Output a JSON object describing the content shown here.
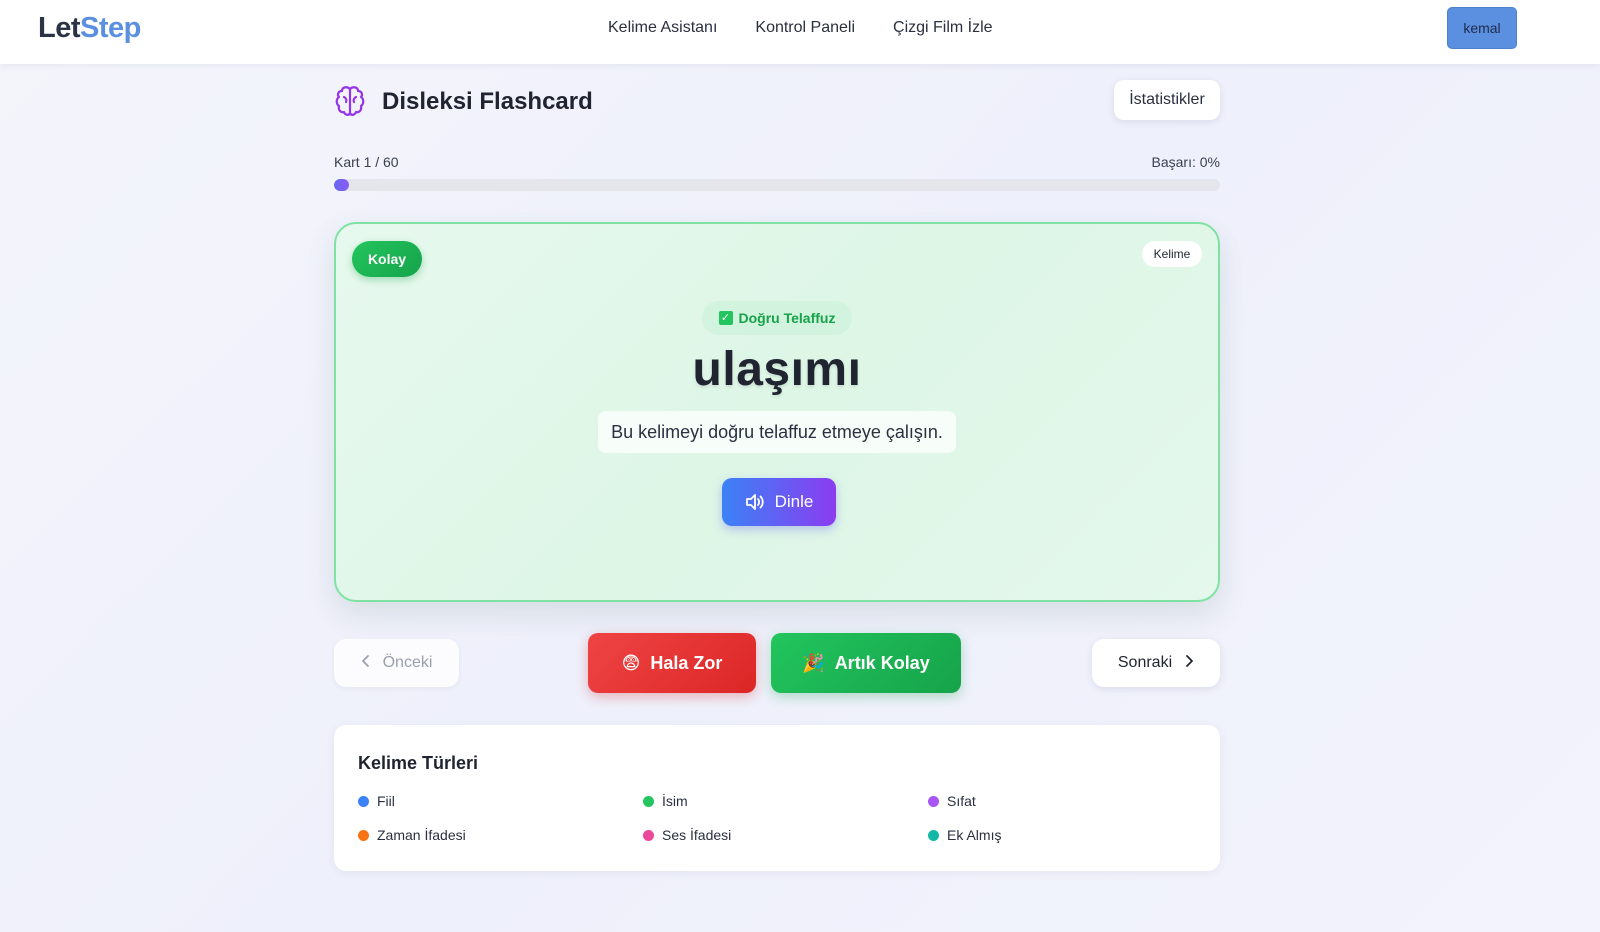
{
  "brand": {
    "part1": "Let",
    "part2": "Step",
    "color_part2": "#5b8fe0"
  },
  "nav": {
    "links": [
      "Kelime Asistanı",
      "Kontrol Paneli",
      "Çizgi Film İzle"
    ],
    "user": "kemal"
  },
  "header": {
    "title": "Disleksi Flashcard",
    "icon": "brain-icon",
    "stats_button": "İstatistikler"
  },
  "progress": {
    "card_label": "Kart 1 / 60",
    "success_label": "Başarı: 0%",
    "fraction": 0.0167
  },
  "card": {
    "level_badge": "Kolay",
    "type_badge": "Kelime",
    "pronunciation_chip": "Doğru Telaffuz",
    "word": "ulaşımı",
    "instruction": "Bu kelimeyi doğru telaffuz etmeye çalışın.",
    "listen_button": "Dinle"
  },
  "actions": {
    "prev": "Önceki",
    "hard": "Hala Zor",
    "easy": "Artık Kolay",
    "next": "Sonraki"
  },
  "legend": {
    "title": "Kelime Türleri",
    "items": [
      {
        "label": "Fiil",
        "color": "#3b82f6"
      },
      {
        "label": "İsim",
        "color": "#22c55e"
      },
      {
        "label": "Sıfat",
        "color": "#a855f7"
      },
      {
        "label": "Zaman İfadesi",
        "color": "#f97316"
      },
      {
        "label": "Ses İfadesi",
        "color": "#ec4899"
      },
      {
        "label": "Ek Almış",
        "color": "#14b8a6"
      }
    ]
  }
}
